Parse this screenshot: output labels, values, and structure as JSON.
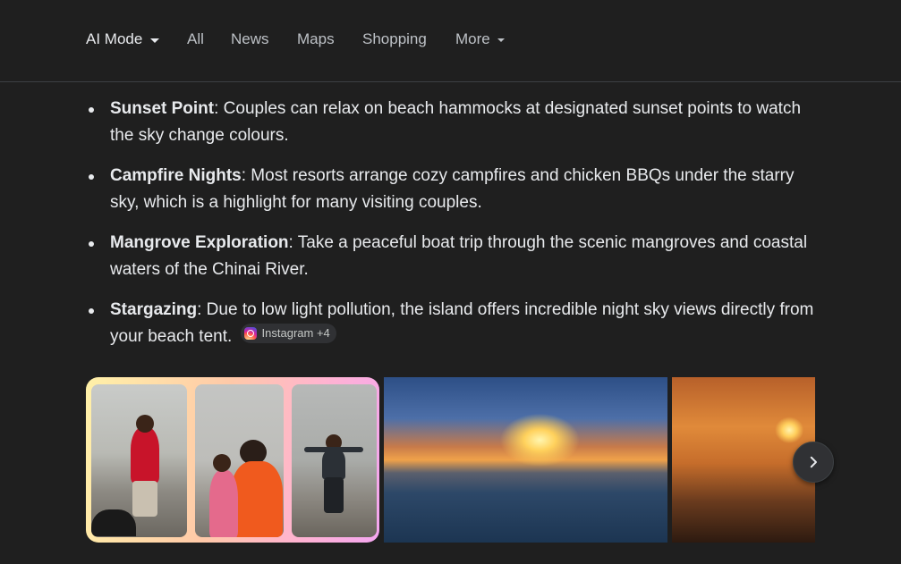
{
  "nav": {
    "tabs": [
      {
        "label": "AI Mode",
        "has_dropdown": true,
        "active": true
      },
      {
        "label": "All"
      },
      {
        "label": "News"
      },
      {
        "label": "Maps"
      },
      {
        "label": "Shopping"
      },
      {
        "label": "More",
        "has_dropdown": true
      }
    ]
  },
  "content": {
    "bullets": [
      {
        "term": "Sunset Point",
        "text": ": Couples can relax on beach hammocks at designated sunset points to watch the sky change colours."
      },
      {
        "term": "Campfire Nights",
        "text": ": Most resorts arrange cozy campfires and chicken BBQs under the starry sky, which is a highlight for many visiting couples."
      },
      {
        "term": "Mangrove Exploration",
        "text": ": Take a peaceful boat trip through the scenic mangroves and coastal waters of the Chinai River."
      },
      {
        "term": "Stargazing",
        "text": ": Due to low light pollution, the island offers incredible night sky views directly from your beach tent."
      }
    ],
    "source_chip": {
      "icon": "instagram-icon",
      "label": "Instagram +4"
    }
  },
  "gallery": {
    "images": [
      "couple-collage",
      "sunset-sea",
      "sunset-boat"
    ],
    "next_icon": "chevron-right-icon"
  },
  "colors": {
    "background": "#1f1f1f",
    "text": "#e8eaed",
    "muted": "#bdc1c6",
    "chip_bg": "#303134"
  }
}
